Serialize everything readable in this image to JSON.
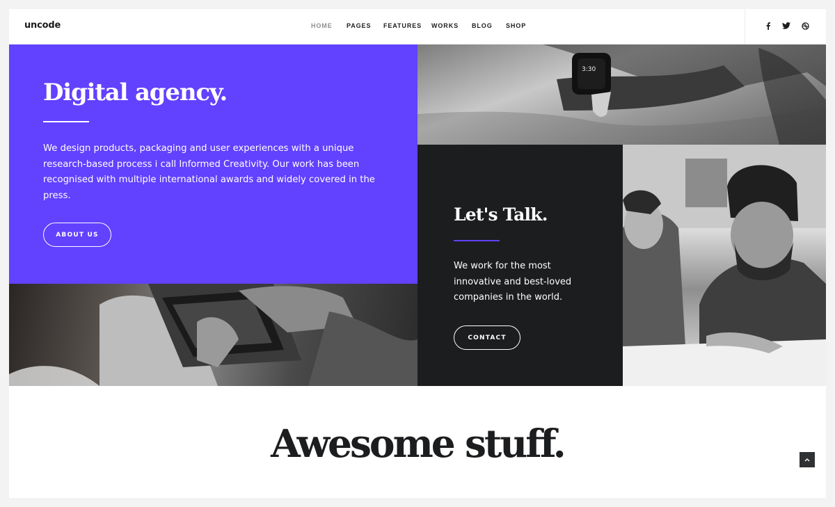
{
  "header": {
    "logo": "uncode",
    "nav": [
      {
        "label": "HOME",
        "active": true
      },
      {
        "label": "PAGES",
        "active": false
      },
      {
        "label": "FEATURES",
        "active": false
      },
      {
        "label": "WORKS",
        "active": false
      },
      {
        "label": "BLOG",
        "active": false
      },
      {
        "label": "SHOP",
        "active": false
      }
    ],
    "social": [
      "facebook-icon",
      "twitter-icon",
      "dribbble-icon"
    ]
  },
  "hero": {
    "digital": {
      "title": "Digital agency.",
      "text": "We design products, packaging and user experiences with a unique research-based process i call Informed Creativity. Our work has been recognised with multiple international awards and widely covered in the press.",
      "button": "ABOUT US"
    },
    "talk": {
      "title": "Let's Talk.",
      "text": "We work for the most innovative and best-loved companies in the world.",
      "button": "CONTACT"
    }
  },
  "section": {
    "title": "Awesome stuff."
  },
  "colors": {
    "accent": "#6241ff",
    "dark": "#1b1d1f",
    "white": "#ffffff"
  }
}
